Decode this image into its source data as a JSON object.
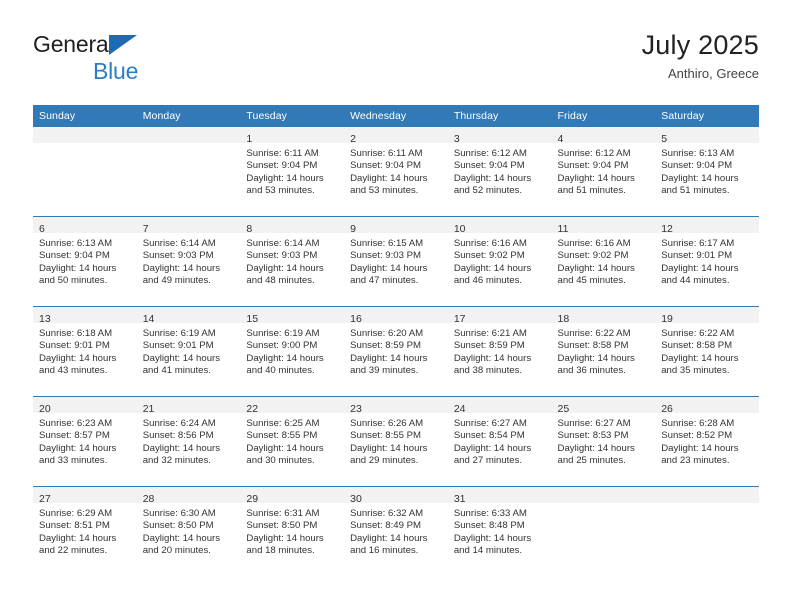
{
  "brand": {
    "word1": "General",
    "word2": "Blue",
    "triangle_color": "#1b6cb5",
    "word1_color": "#231f20",
    "word2_color": "#2a7fc9"
  },
  "header": {
    "title": "July 2025",
    "subtitle": "Anthiro, Greece"
  },
  "theme": {
    "header_band": "#3279b7",
    "daynum_band": "#f2f2f2",
    "text": "#333333",
    "page_background": "#ffffff"
  },
  "weekday_headers": [
    "Sunday",
    "Monday",
    "Tuesday",
    "Wednesday",
    "Thursday",
    "Friday",
    "Saturday"
  ],
  "weeks": [
    [
      {
        "day": "",
        "lines": []
      },
      {
        "day": "",
        "lines": []
      },
      {
        "day": "1",
        "lines": [
          "Sunrise: 6:11 AM",
          "Sunset: 9:04 PM",
          "Daylight: 14 hours",
          "and 53 minutes."
        ]
      },
      {
        "day": "2",
        "lines": [
          "Sunrise: 6:11 AM",
          "Sunset: 9:04 PM",
          "Daylight: 14 hours",
          "and 53 minutes."
        ]
      },
      {
        "day": "3",
        "lines": [
          "Sunrise: 6:12 AM",
          "Sunset: 9:04 PM",
          "Daylight: 14 hours",
          "and 52 minutes."
        ]
      },
      {
        "day": "4",
        "lines": [
          "Sunrise: 6:12 AM",
          "Sunset: 9:04 PM",
          "Daylight: 14 hours",
          "and 51 minutes."
        ]
      },
      {
        "day": "5",
        "lines": [
          "Sunrise: 6:13 AM",
          "Sunset: 9:04 PM",
          "Daylight: 14 hours",
          "and 51 minutes."
        ]
      }
    ],
    [
      {
        "day": "6",
        "lines": [
          "Sunrise: 6:13 AM",
          "Sunset: 9:04 PM",
          "Daylight: 14 hours",
          "and 50 minutes."
        ]
      },
      {
        "day": "7",
        "lines": [
          "Sunrise: 6:14 AM",
          "Sunset: 9:03 PM",
          "Daylight: 14 hours",
          "and 49 minutes."
        ]
      },
      {
        "day": "8",
        "lines": [
          "Sunrise: 6:14 AM",
          "Sunset: 9:03 PM",
          "Daylight: 14 hours",
          "and 48 minutes."
        ]
      },
      {
        "day": "9",
        "lines": [
          "Sunrise: 6:15 AM",
          "Sunset: 9:03 PM",
          "Daylight: 14 hours",
          "and 47 minutes."
        ]
      },
      {
        "day": "10",
        "lines": [
          "Sunrise: 6:16 AM",
          "Sunset: 9:02 PM",
          "Daylight: 14 hours",
          "and 46 minutes."
        ]
      },
      {
        "day": "11",
        "lines": [
          "Sunrise: 6:16 AM",
          "Sunset: 9:02 PM",
          "Daylight: 14 hours",
          "and 45 minutes."
        ]
      },
      {
        "day": "12",
        "lines": [
          "Sunrise: 6:17 AM",
          "Sunset: 9:01 PM",
          "Daylight: 14 hours",
          "and 44 minutes."
        ]
      }
    ],
    [
      {
        "day": "13",
        "lines": [
          "Sunrise: 6:18 AM",
          "Sunset: 9:01 PM",
          "Daylight: 14 hours",
          "and 43 minutes."
        ]
      },
      {
        "day": "14",
        "lines": [
          "Sunrise: 6:19 AM",
          "Sunset: 9:01 PM",
          "Daylight: 14 hours",
          "and 41 minutes."
        ]
      },
      {
        "day": "15",
        "lines": [
          "Sunrise: 6:19 AM",
          "Sunset: 9:00 PM",
          "Daylight: 14 hours",
          "and 40 minutes."
        ]
      },
      {
        "day": "16",
        "lines": [
          "Sunrise: 6:20 AM",
          "Sunset: 8:59 PM",
          "Daylight: 14 hours",
          "and 39 minutes."
        ]
      },
      {
        "day": "17",
        "lines": [
          "Sunrise: 6:21 AM",
          "Sunset: 8:59 PM",
          "Daylight: 14 hours",
          "and 38 minutes."
        ]
      },
      {
        "day": "18",
        "lines": [
          "Sunrise: 6:22 AM",
          "Sunset: 8:58 PM",
          "Daylight: 14 hours",
          "and 36 minutes."
        ]
      },
      {
        "day": "19",
        "lines": [
          "Sunrise: 6:22 AM",
          "Sunset: 8:58 PM",
          "Daylight: 14 hours",
          "and 35 minutes."
        ]
      }
    ],
    [
      {
        "day": "20",
        "lines": [
          "Sunrise: 6:23 AM",
          "Sunset: 8:57 PM",
          "Daylight: 14 hours",
          "and 33 minutes."
        ]
      },
      {
        "day": "21",
        "lines": [
          "Sunrise: 6:24 AM",
          "Sunset: 8:56 PM",
          "Daylight: 14 hours",
          "and 32 minutes."
        ]
      },
      {
        "day": "22",
        "lines": [
          "Sunrise: 6:25 AM",
          "Sunset: 8:55 PM",
          "Daylight: 14 hours",
          "and 30 minutes."
        ]
      },
      {
        "day": "23",
        "lines": [
          "Sunrise: 6:26 AM",
          "Sunset: 8:55 PM",
          "Daylight: 14 hours",
          "and 29 minutes."
        ]
      },
      {
        "day": "24",
        "lines": [
          "Sunrise: 6:27 AM",
          "Sunset: 8:54 PM",
          "Daylight: 14 hours",
          "and 27 minutes."
        ]
      },
      {
        "day": "25",
        "lines": [
          "Sunrise: 6:27 AM",
          "Sunset: 8:53 PM",
          "Daylight: 14 hours",
          "and 25 minutes."
        ]
      },
      {
        "day": "26",
        "lines": [
          "Sunrise: 6:28 AM",
          "Sunset: 8:52 PM",
          "Daylight: 14 hours",
          "and 23 minutes."
        ]
      }
    ],
    [
      {
        "day": "27",
        "lines": [
          "Sunrise: 6:29 AM",
          "Sunset: 8:51 PM",
          "Daylight: 14 hours",
          "and 22 minutes."
        ]
      },
      {
        "day": "28",
        "lines": [
          "Sunrise: 6:30 AM",
          "Sunset: 8:50 PM",
          "Daylight: 14 hours",
          "and 20 minutes."
        ]
      },
      {
        "day": "29",
        "lines": [
          "Sunrise: 6:31 AM",
          "Sunset: 8:50 PM",
          "Daylight: 14 hours",
          "and 18 minutes."
        ]
      },
      {
        "day": "30",
        "lines": [
          "Sunrise: 6:32 AM",
          "Sunset: 8:49 PM",
          "Daylight: 14 hours",
          "and 16 minutes."
        ]
      },
      {
        "day": "31",
        "lines": [
          "Sunrise: 6:33 AM",
          "Sunset: 8:48 PM",
          "Daylight: 14 hours",
          "and 14 minutes."
        ]
      },
      {
        "day": "",
        "lines": []
      },
      {
        "day": "",
        "lines": []
      }
    ]
  ]
}
